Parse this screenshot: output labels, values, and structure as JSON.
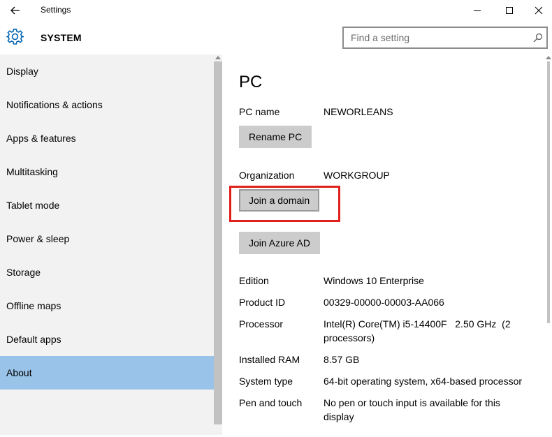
{
  "window": {
    "title": "Settings"
  },
  "header": {
    "title": "SYSTEM",
    "search_placeholder": "Find a setting"
  },
  "sidebar": {
    "items": [
      {
        "label": "Display"
      },
      {
        "label": "Notifications & actions"
      },
      {
        "label": "Apps & features"
      },
      {
        "label": "Multitasking"
      },
      {
        "label": "Tablet mode"
      },
      {
        "label": "Power & sleep"
      },
      {
        "label": "Storage"
      },
      {
        "label": "Offline maps"
      },
      {
        "label": "Default apps"
      },
      {
        "label": "About",
        "active": true
      }
    ]
  },
  "content": {
    "heading": "PC",
    "pc_name_label": "PC name",
    "pc_name_value": "NEWORLEANS",
    "rename_button": "Rename PC",
    "organization_label": "Organization",
    "organization_value": "WORKGROUP",
    "join_domain_button": "Join a domain",
    "join_azure_button": "Join Azure AD",
    "specs": [
      {
        "label": "Edition",
        "value": "Windows 10 Enterprise"
      },
      {
        "label": "Product ID",
        "value": "00329-00000-00003-AA066"
      },
      {
        "label": "Processor",
        "value": "Intel(R) Core(TM) i5-14400F   2.50 GHz  (2 processors)"
      },
      {
        "label": "Installed RAM",
        "value": "8.57 GB"
      },
      {
        "label": "System type",
        "value": "64-bit operating system, x64-based processor"
      },
      {
        "label": "Pen and touch",
        "value": "No pen or touch input is available for this display"
      }
    ]
  },
  "colors": {
    "accent": "#99c3e8",
    "highlight": "#e0201b",
    "link": "#0066cc"
  }
}
